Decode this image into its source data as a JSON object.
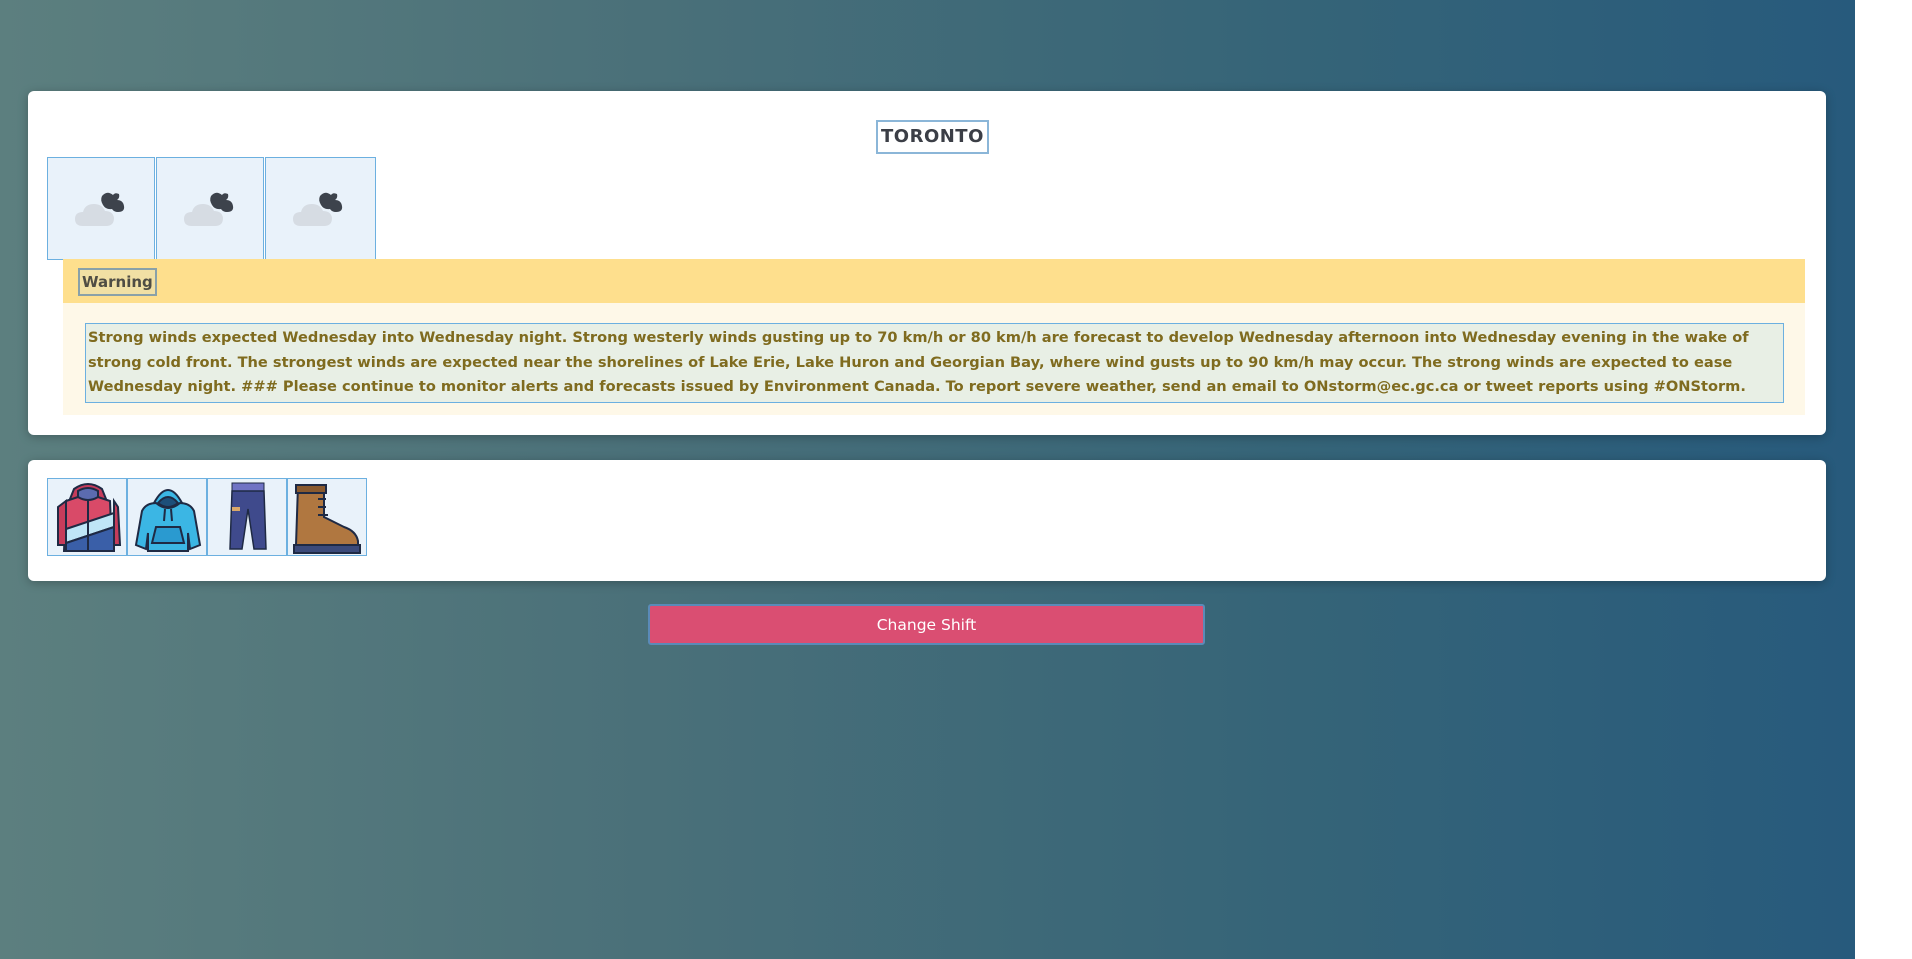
{
  "location": {
    "city": "TORONTO"
  },
  "forecast": {
    "icons": [
      "cloudy-night-icon",
      "cloudy-night-icon",
      "cloudy-night-icon"
    ]
  },
  "alert": {
    "label": "Warning",
    "text": "Strong winds expected Wednesday into Wednesday night. Strong westerly winds gusting up to 70 km/h or 80 km/h are forecast to develop Wednesday afternoon into Wednesday evening in the wake of strong cold front. The strongest winds are expected near the shorelines of Lake Erie, Lake Huron and Georgian Bay, where wind gusts up to 90 km/h may occur. The strong winds are expected to ease Wednesday night. ### Please continue to monitor alerts and forecasts issued by Environment Canada. To report severe weather, send an email to ONstorm@ec.gc.ca or tweet reports using #ONStorm."
  },
  "clothing": {
    "items": [
      "winter-jacket-icon",
      "hoodie-icon",
      "pants-icon",
      "boot-icon"
    ]
  },
  "actions": {
    "change_shift_label": "Change Shift"
  },
  "colors": {
    "accent_button": "#da4e72",
    "warning_header": "#fedf8d",
    "warning_text": "#7f6b1f",
    "outline": "#6cb0e0"
  }
}
